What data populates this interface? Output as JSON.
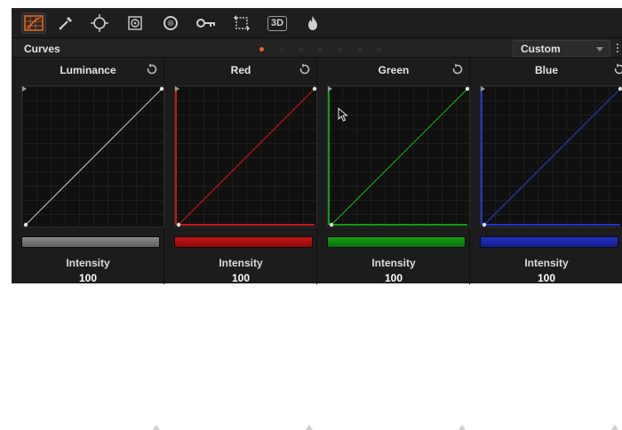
{
  "toolbar": {
    "tools": [
      {
        "icon": "curves-icon",
        "active": true
      },
      {
        "icon": "qualifier-picker-icon"
      },
      {
        "icon": "window-icon"
      },
      {
        "icon": "tracker-icon"
      },
      {
        "icon": "blur-icon"
      },
      {
        "icon": "key-icon"
      },
      {
        "icon": "sizing-icon"
      },
      {
        "icon": "3d-label",
        "label": "3D"
      },
      {
        "icon": "color-flame-icon"
      }
    ]
  },
  "panel": {
    "title": "Curves",
    "preset": "Custom",
    "page_count": 7,
    "active_page": 1
  },
  "channels": [
    {
      "name": "Luminance",
      "color": "#c8c8c8",
      "bar_color": "#6b6b6b",
      "intensity_label": "Intensity",
      "intensity": "100"
    },
    {
      "name": "Red",
      "color": "#d11a1a",
      "bar_color": "#b10c0c",
      "intensity_label": "Intensity",
      "intensity": "100"
    },
    {
      "name": "Green",
      "color": "#1fae1f",
      "bar_color": "#0f7f0f",
      "intensity_label": "Intensity",
      "intensity": "100"
    },
    {
      "name": "Blue",
      "color": "#2a3ad8",
      "bar_color": "#1a23a6",
      "intensity_label": "Intensity",
      "intensity": "100"
    }
  ],
  "colors": {
    "accent": "#e8661c",
    "panel_bg": "#1c1c1d"
  }
}
